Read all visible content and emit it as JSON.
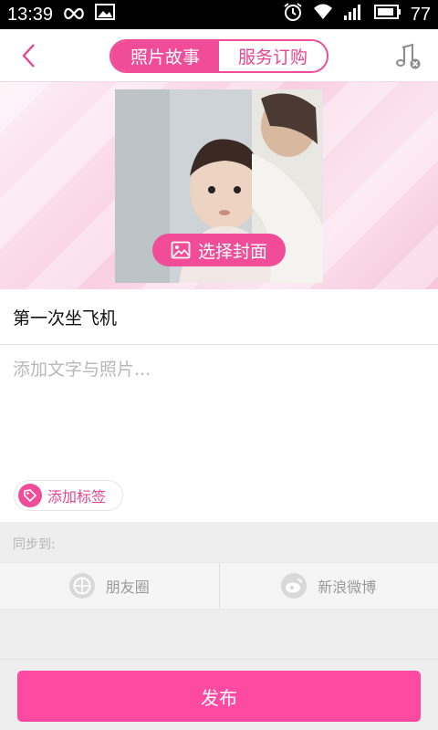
{
  "status_bar": {
    "time": "13:39",
    "battery": "77",
    "icons": [
      "infinity-icon",
      "image-icon",
      "alarm-icon",
      "wifi-icon",
      "signal-icon",
      "battery-icon"
    ]
  },
  "header": {
    "tabs": [
      {
        "label": "照片故事",
        "active": true
      },
      {
        "label": "服务订购",
        "active": false
      }
    ],
    "back_icon": "chevron-left-icon",
    "music_icon": "music-note-off-icon"
  },
  "cover": {
    "choose_label": "选择封面",
    "choose_icon": "image-icon"
  },
  "form": {
    "title_value": "第一次坐飞机",
    "content_placeholder": "添加文字与照片..."
  },
  "tag": {
    "label": "添加标签",
    "icon": "tag-icon"
  },
  "sync": {
    "label": "同步到:",
    "options": [
      {
        "label": "朋友圈",
        "icon": "wechat-moments-icon"
      },
      {
        "label": "新浪微博",
        "icon": "weibo-icon"
      }
    ]
  },
  "publish_label": "发布",
  "colors": {
    "accent": "#f04c97",
    "publish": "#fe4aa0",
    "placeholder": "#b8b8b8"
  }
}
